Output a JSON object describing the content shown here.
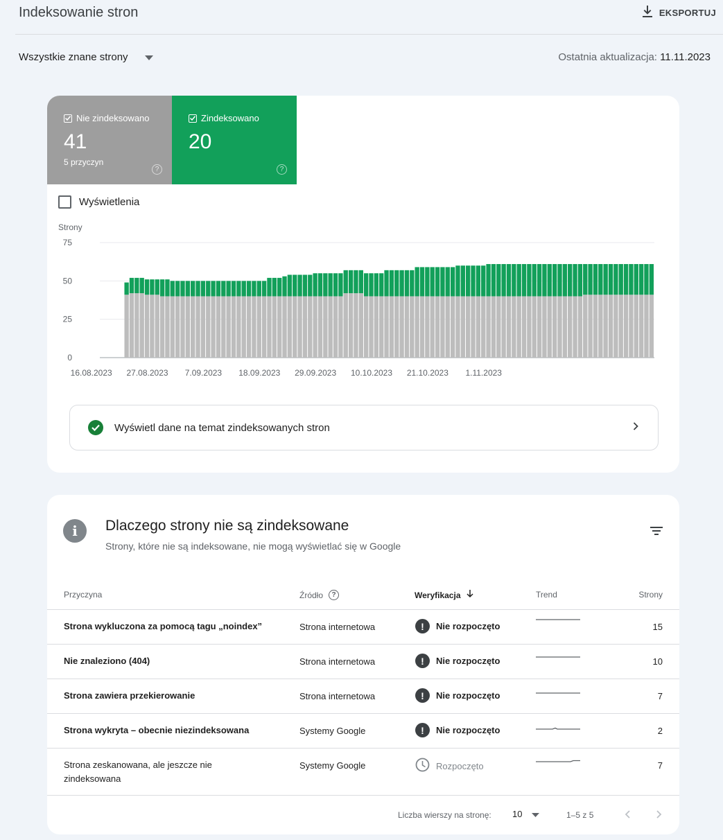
{
  "header": {
    "title": "Indeksowanie stron",
    "export_label": "EKSPORTUJ"
  },
  "filter": {
    "selected": "Wszystkie znane strony",
    "last_update_label": "Ostatnia aktualizacja:",
    "last_update_date": "11.11.2023"
  },
  "summary": {
    "not_indexed": {
      "label": "Nie zindeksowano",
      "value": "41",
      "sub": "5 przyczyn",
      "color": "#9e9e9e"
    },
    "indexed": {
      "label": "Zindeksowano",
      "value": "20",
      "color": "#12a05a"
    },
    "impressions_label": "Wyświetlenia"
  },
  "chart_data": {
    "type": "bar",
    "stacked": true,
    "ylabel": "Strony",
    "ylim": [
      0,
      75
    ],
    "yticks": [
      0,
      25,
      50,
      75
    ],
    "grid": true,
    "x_tick_labels": [
      "16.08.2023",
      "27.08.2023",
      "7.09.2023",
      "18.09.2023",
      "29.09.2023",
      "10.10.2023",
      "21.10.2023",
      "1.11.2023"
    ],
    "x_tick_indices": [
      0,
      11,
      22,
      33,
      44,
      55,
      66,
      77
    ],
    "series": [
      {
        "name": "Nie zindeksowano",
        "color": "#bdbdbd",
        "values": [
          0,
          0,
          0,
          0,
          0,
          0,
          0,
          41,
          42,
          42,
          42,
          41,
          41,
          41,
          40,
          40,
          40,
          40,
          40,
          40,
          40,
          40,
          40,
          40,
          40,
          40,
          40,
          40,
          40,
          40,
          40,
          40,
          40,
          40,
          40,
          40,
          40,
          40,
          40,
          40,
          40,
          40,
          40,
          40,
          40,
          40,
          40,
          40,
          40,
          40,
          42,
          42,
          42,
          42,
          40,
          40,
          40,
          40,
          40,
          40,
          40,
          40,
          40,
          40,
          40,
          40,
          40,
          40,
          40,
          40,
          40,
          40,
          40,
          40,
          40,
          40,
          40,
          40,
          40,
          40,
          40,
          40,
          40,
          40,
          40,
          40,
          40,
          40,
          40,
          40,
          40,
          40,
          40,
          40,
          40,
          40,
          40,
          41,
          41,
          41,
          41,
          41,
          41,
          41,
          41,
          41,
          41,
          41,
          41,
          41,
          41
        ]
      },
      {
        "name": "Zindeksowano",
        "color": "#12a05a",
        "values": [
          0,
          0,
          0,
          0,
          0,
          0,
          0,
          8,
          10,
          10,
          10,
          10,
          10,
          10,
          11,
          11,
          10,
          10,
          10,
          10,
          10,
          10,
          10,
          10,
          10,
          10,
          10,
          10,
          10,
          10,
          10,
          10,
          10,
          10,
          10,
          12,
          12,
          12,
          13,
          14,
          14,
          14,
          14,
          14,
          15,
          15,
          15,
          15,
          15,
          15,
          15,
          15,
          15,
          15,
          15,
          15,
          15,
          15,
          17,
          17,
          17,
          17,
          17,
          17,
          19,
          19,
          19,
          19,
          19,
          19,
          19,
          19,
          20,
          20,
          20,
          20,
          20,
          20,
          21,
          21,
          21,
          21,
          21,
          21,
          21,
          21,
          21,
          21,
          21,
          21,
          21,
          21,
          21,
          21,
          21,
          21,
          21,
          20,
          20,
          20,
          20,
          20,
          20,
          20,
          20,
          20,
          20,
          20,
          20,
          20,
          20
        ]
      }
    ]
  },
  "cta": {
    "label": "Wyświetl dane na temat zindeksowanych stron"
  },
  "reasons": {
    "title": "Dlaczego strony nie są zindeksowane",
    "subtitle": "Strony, które nie są indeksowane, nie mogą wyświetlać się w Google",
    "columns": {
      "reason": "Przyczyna",
      "source": "Źródło",
      "verification": "Weryfikacja",
      "trend": "Trend",
      "pages": "Strony"
    },
    "rows": [
      {
        "reason": "Strona wykluczona za pomocą tagu „noindex”",
        "source": "Strona internetowa",
        "status": "Nie rozpoczęto",
        "pages": "15"
      },
      {
        "reason": "Nie znaleziono (404)",
        "source": "Strona internetowa",
        "status": "Nie rozpoczęto",
        "pages": "10"
      },
      {
        "reason": "Strona zawiera przekierowanie",
        "source": "Strona internetowa",
        "status": "Nie rozpoczęto",
        "pages": "7"
      },
      {
        "reason": "Strona wykryta – obecnie niezindeksowana",
        "source": "Systemy Google",
        "status": "Nie rozpoczęto",
        "pages": "2"
      },
      {
        "reason": "Strona zeskanowana, ale jeszcze nie zindeksowana",
        "source": "Systemy Google",
        "status": "Rozpoczęto",
        "pages": "7"
      }
    ],
    "pager": {
      "rows_label": "Liczba wierszy na stronę:",
      "rows_value": "10",
      "range": "1–5 z 5"
    }
  }
}
